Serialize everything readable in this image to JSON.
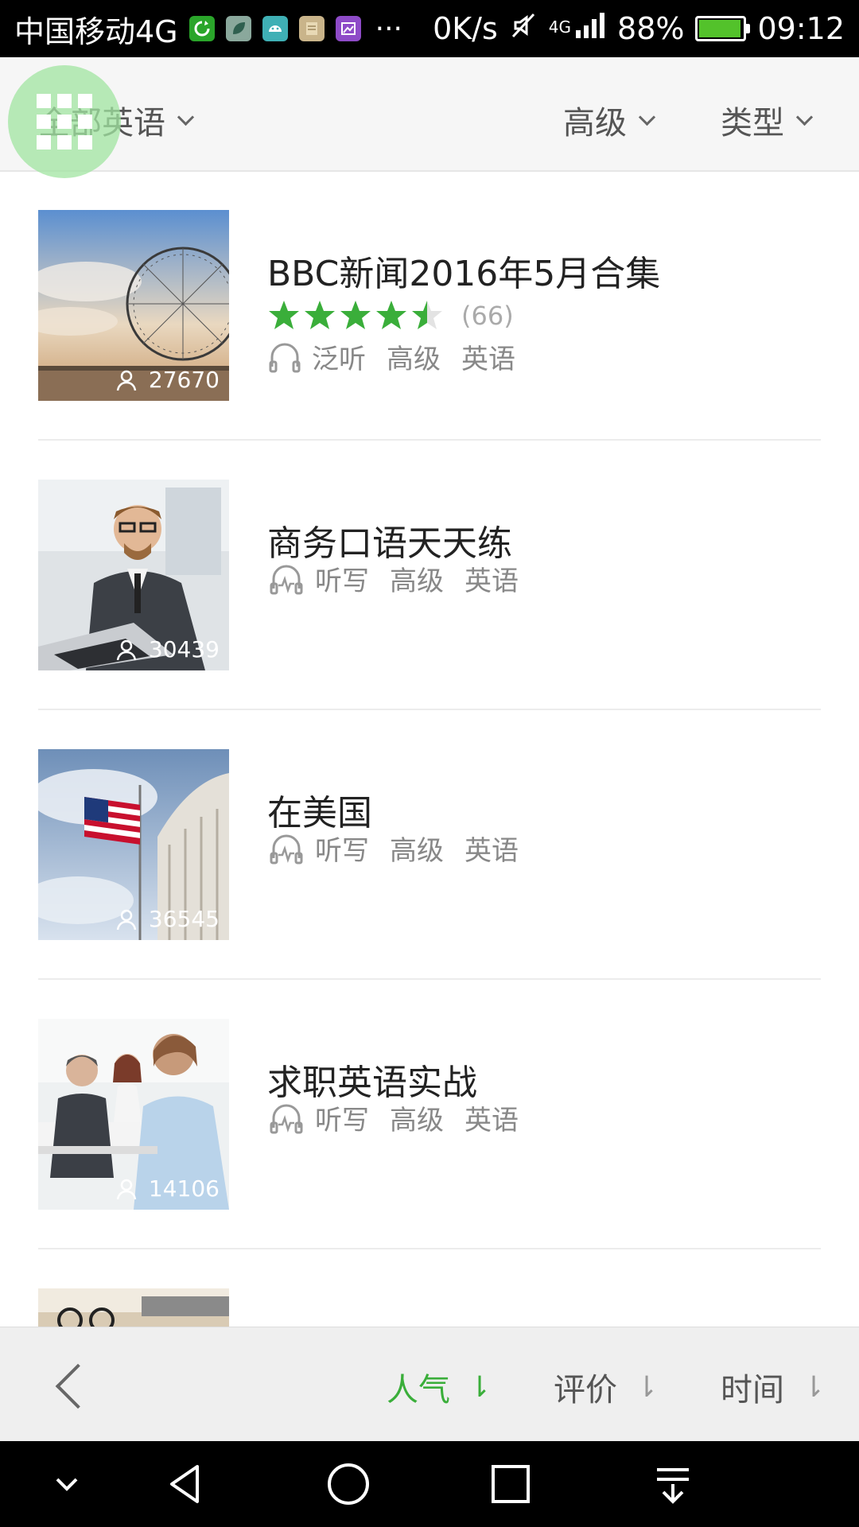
{
  "status_bar": {
    "carrier": "中国移动4G",
    "speed": "0K/s",
    "network": "4G",
    "battery": "88%",
    "time": "09:12"
  },
  "filters": [
    {
      "label": "全部英语"
    },
    {
      "label": "高级"
    },
    {
      "label": "类型"
    }
  ],
  "items": [
    {
      "title": "BBC新闻2016年5月合集",
      "rating": 4.5,
      "reviews": "(66)",
      "listeners": "27670",
      "type": "泛听",
      "level": "高级",
      "language": "英语",
      "icon": "headphones-icon"
    },
    {
      "title": "商务口语天天练",
      "listeners": "30439",
      "type": "听写",
      "level": "高级",
      "language": "英语",
      "icon": "dictation-icon"
    },
    {
      "title": "在美国",
      "listeners": "36545",
      "type": "听写",
      "level": "高级",
      "language": "英语",
      "icon": "dictation-icon"
    },
    {
      "title": "求职英语实战",
      "listeners": "14106",
      "type": "听写",
      "level": "高级",
      "language": "英语",
      "icon": "dictation-icon"
    }
  ],
  "sort_bar": {
    "options": [
      {
        "label": "人气",
        "active": true
      },
      {
        "label": "评价",
        "active": false
      },
      {
        "label": "时间",
        "active": false
      }
    ],
    "arrow": "⇂"
  },
  "colors": {
    "accent": "#3aae3a",
    "star": "#3aae3a"
  }
}
